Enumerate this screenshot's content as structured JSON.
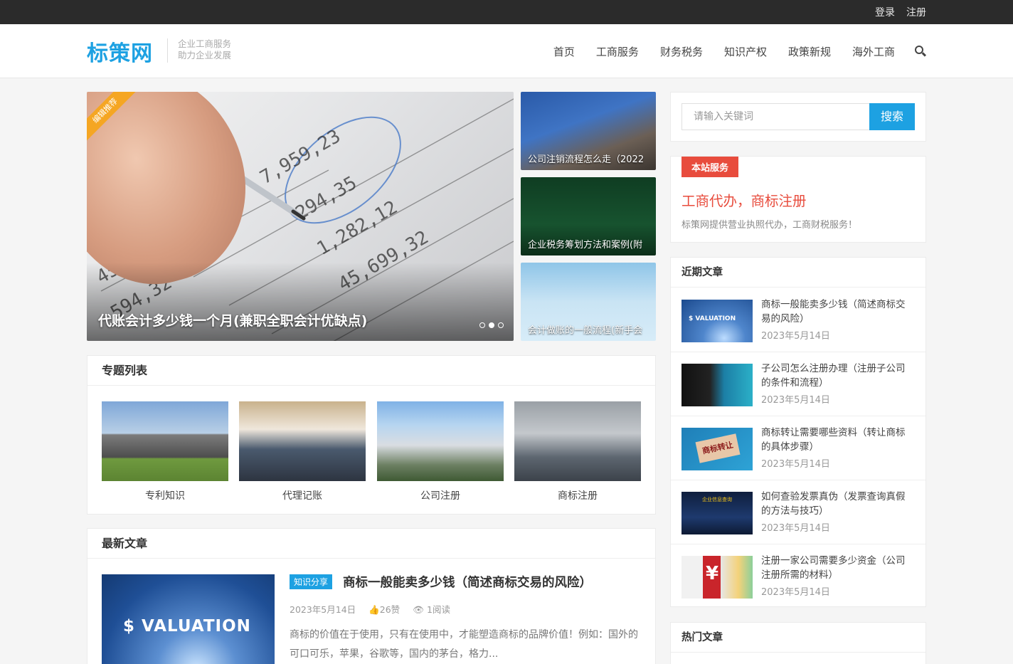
{
  "topbar": {
    "login": "登录",
    "register": "注册"
  },
  "header": {
    "logo": "标策网",
    "slogan_line1": "企业工商服务",
    "slogan_line2": "助力企业发展",
    "nav": [
      "首页",
      "工商服务",
      "财务税务",
      "知识产权",
      "政策新规",
      "海外工商"
    ]
  },
  "slider": {
    "ribbon": "编辑推荐",
    "caption": "代账会计多少钱一个月(兼职全职会计优缺点)",
    "dots": 3,
    "active_dot": 2
  },
  "side_cards": [
    {
      "caption": "公司注销流程怎么走（2022"
    },
    {
      "caption": "企业税务筹划方法和案例(附"
    },
    {
      "caption": "会计做账的一般流程(新手会"
    }
  ],
  "topics": {
    "title": "专题列表",
    "items": [
      "专利知识",
      "代理记账",
      "公司注册",
      "商标注册"
    ]
  },
  "latest": {
    "title": "最新文章",
    "thumb_text": "$ VALUATION",
    "tag": "知识分享",
    "post_title": "商标一般能卖多少钱（简述商标交易的风险）",
    "date": "2023年5月14日",
    "likes": "26赞",
    "reads": "1阅读",
    "excerpt": "商标的价值在于使用，只有在使用中，才能塑造商标的品牌价值！例如：国外的可口可乐，苹果，谷歌等，国内的茅台，格力..."
  },
  "search": {
    "placeholder": "请输入关键词",
    "button": "搜索"
  },
  "service": {
    "tag": "本站服务",
    "title": "工商代办，商标注册",
    "desc": "标策网提供营业执照代办，工商财税服务！"
  },
  "recent": {
    "title": "近期文章",
    "items": [
      {
        "title": "商标一般能卖多少钱（简述商标交易的风险）",
        "date": "2023年5月14日",
        "thumb_text": "$ VALUATION"
      },
      {
        "title": "子公司怎么注册办理（注册子公司的条件和流程）",
        "date": "2023年5月14日"
      },
      {
        "title": "商标转让需要哪些资料（转让商标的具体步骤）",
        "date": "2023年5月14日",
        "thumb_text": "商标转让"
      },
      {
        "title": "如何查验发票真伪（发票查询真假的方法与技巧）",
        "date": "2023年5月14日",
        "thumb_text": "企业信息查询"
      },
      {
        "title": "注册一家公司需要多少资金（公司注册所需的材料）",
        "date": "2023年5月14日"
      }
    ]
  },
  "hot": {
    "title": "热门文章"
  }
}
